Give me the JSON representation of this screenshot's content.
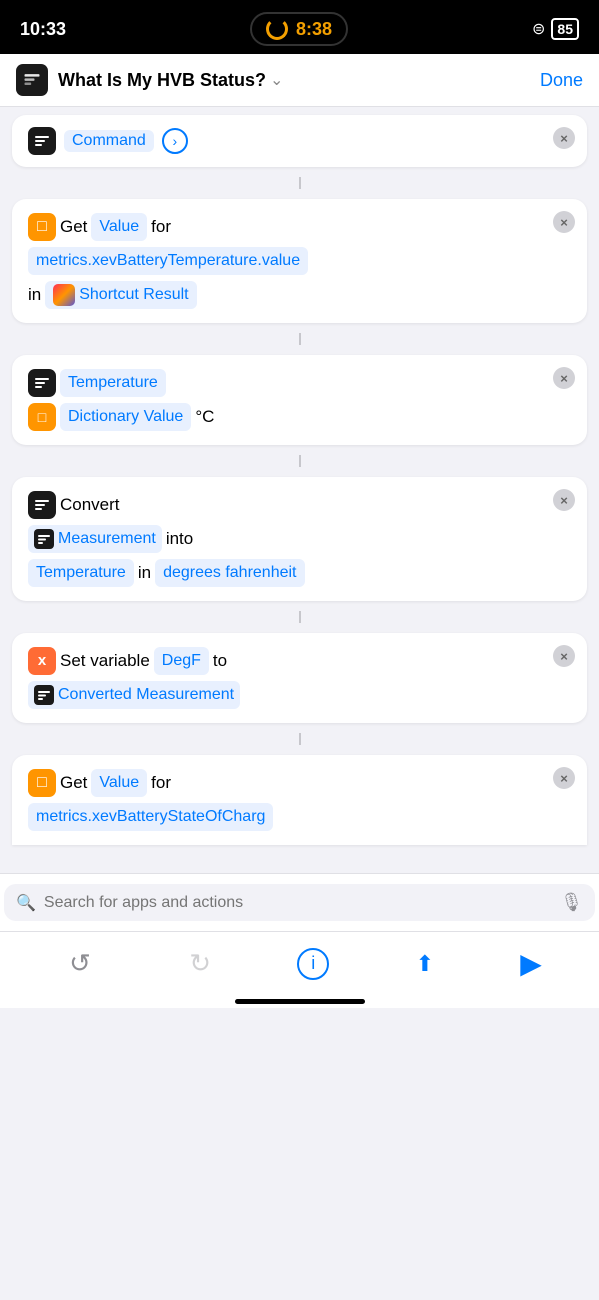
{
  "statusBar": {
    "time": "10:33",
    "centerTime": "8:38",
    "battery": "85"
  },
  "navBar": {
    "title": "What Is My HVB Status?",
    "doneLabel": "Done"
  },
  "card0": {
    "label": "Command"
  },
  "card1": {
    "prefix": "Get",
    "valueToken": "Value",
    "middle": "for",
    "path": "metrics.xevBatteryTemperature.value",
    "inLabel": "in",
    "resultToken": "Shortcut Result"
  },
  "card2": {
    "nameToken": "Temperature",
    "dictToken": "Dictionary Value",
    "unit": "°C"
  },
  "card3": {
    "prefix": "Convert",
    "measureToken": "Measurement",
    "intoLabel": "into",
    "tempToken": "Temperature",
    "inLabel": "in",
    "degreesToken": "degrees fahrenheit"
  },
  "card4": {
    "prefix": "Set variable",
    "varToken": "DegF",
    "toLabel": "to",
    "valueToken": "Converted Measurement"
  },
  "card5": {
    "prefix": "Get",
    "valueToken": "Value",
    "middle": "for",
    "pathPartial": "metrics.xevBatteryStateOfCharg"
  },
  "searchBar": {
    "placeholder": "Search for apps and actions"
  },
  "toolbar": {
    "undoLabel": "↺",
    "redoLabel": "↻",
    "infoLabel": "ⓘ",
    "shareLabel": "⬆",
    "playLabel": "▶"
  }
}
